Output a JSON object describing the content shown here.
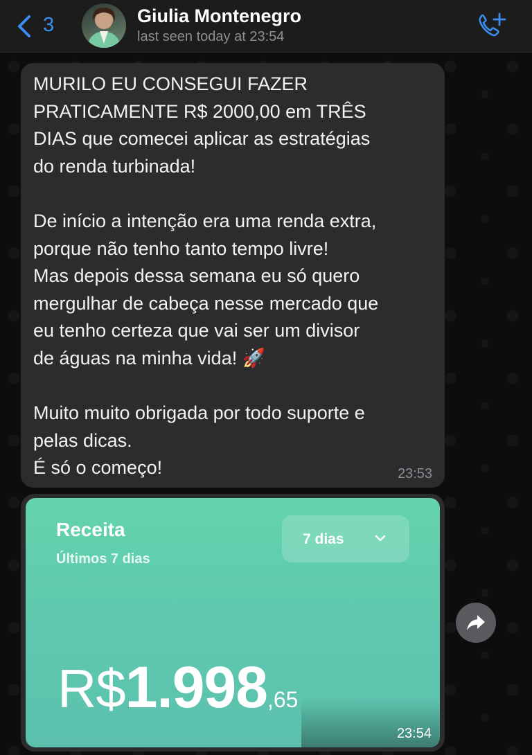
{
  "header": {
    "back_count": "3",
    "contact_name": "Giulia Montenegro",
    "last_seen": "last seen today at 23:54",
    "accent_color": "#3b8ef0"
  },
  "messages": {
    "text_message": {
      "body": "MURILO EU CONSEGUI FAZER\nPRATICAMENTE R$ 2000,00 em TRÊS\nDIAS que comecei aplicar as estratégias\ndo renda turbinada!\n\nDe início a intenção era uma renda extra,\nporque não tenho tanto tempo livre!\nMas depois dessa semana eu só quero\nmergulhar de cabeça nesse mercado que\neu tenho certeza que vai ser um divisor\nde águas na minha vida! 🚀\n\nMuito muito obrigada por todo suporte e\npelas dicas.\nÉ só o começo!",
      "time": "23:53"
    },
    "image_message": {
      "card": {
        "title": "Receita",
        "subtitle": "Últimos 7 dias",
        "period": "7 dias",
        "currency": "R$",
        "amount_integer": "1.998",
        "amount_cents": ",65",
        "bg_color": "#5fcbac"
      },
      "time": "23:54"
    }
  },
  "icons": {
    "back": "chevron-left-icon",
    "call": "phone-plus-icon",
    "forward": "forward-arrow-icon",
    "dropdown": "chevron-down-icon"
  }
}
